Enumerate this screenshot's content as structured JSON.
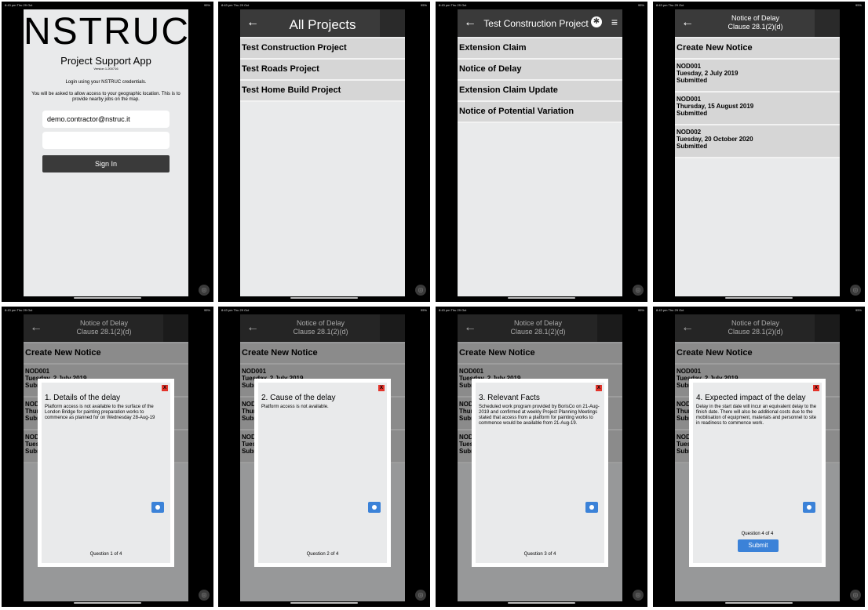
{
  "status": {
    "time": "8:43 pm",
    "date": "Thu 29 Oct",
    "battery": "95%"
  },
  "login": {
    "logo": "NSTRUC",
    "app_name": "Project Support App",
    "version": "Version 1.200716",
    "instruction": "Login using your NSTRUC credentials.",
    "location_note": "You will be asked to allow access to your geographic location. This is to provide nearby jobs on the map.",
    "username": "demo.contractor@nstruc.it",
    "sign_in": "Sign In"
  },
  "projects": {
    "title": "All Projects",
    "items": [
      "Test Construction Project",
      "Test Roads Project",
      "Test Home Build Project"
    ]
  },
  "project": {
    "title": "Test Construction Project",
    "items": [
      "Extension Claim",
      "Notice of Delay",
      "Extension Claim Update",
      "Notice of Potential Variation"
    ]
  },
  "notices": {
    "title": "Notice of Delay",
    "subtitle": "Clause 28.1(2)(d)",
    "create": "Create New Notice",
    "items": [
      {
        "id": "NOD001",
        "date": "Tuesday, 2 July 2019",
        "status": "Submitted"
      },
      {
        "id": "NOD001",
        "date": "Thursday, 15 August 2019",
        "status": "Submitted"
      },
      {
        "id": "NOD002",
        "date": "Tuesday, 20 October 2020",
        "status": "Submitted"
      }
    ]
  },
  "questions": [
    {
      "title": "1. Details of the delay",
      "text": "Platform access is not available to the surface of the London Bridge for painting preparation works to commence as planned for on Wednesday 28-Aug-19",
      "count": "Question 1 of 4"
    },
    {
      "title": "2. Cause of the delay",
      "text": "Platform access is not available.",
      "count": "Question 2 of 4"
    },
    {
      "title": "3. Relevant Facts",
      "text": "Scheduled work program provided by BorisCo on 21-Aug-2019 and confirmed at weekly Project Planning Meetings stated that access from a platform for painting works to commence would be available from 21-Aug-19.",
      "count": "Question 3 of 4"
    },
    {
      "title": "4. Expected impact of the delay",
      "text": "Delay in the start date will incur an equivalent delay to the finish date. There will also be additional costs due to the mobilisation of equipment, materials and personnel to site in readiness to commence work.",
      "count": "Question 4 of 4",
      "submit": "Submit"
    }
  ],
  "icons": {
    "back": "arrow-left-icon",
    "camera": "camera-icon",
    "close": "close-icon",
    "gear": "gear-icon",
    "menu": "hamburger-menu-icon"
  },
  "colors": {
    "accent": "#3b82d8",
    "close": "#e4342b",
    "header": "#3a3a3a"
  }
}
